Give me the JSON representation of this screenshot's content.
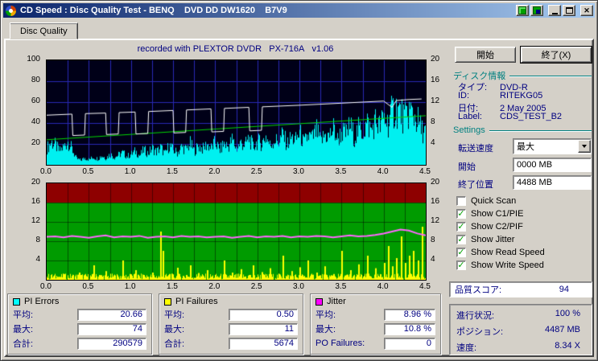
{
  "window": {
    "title": "CD Speed : Disc Quality Test - BENQ    DVD DD DW1620    B7V9"
  },
  "tab": {
    "label": "Disc Quality"
  },
  "chart_header": "recorded with PLEXTOR DVDR   PX-716A   v1.06",
  "colors": {
    "section_header": "#008080",
    "info_text": "#000080",
    "pi_errors": "#00FFFF",
    "pi_failures": "#FFFF00",
    "jitter": "#FF00FF"
  },
  "chart_data": [
    {
      "type": "area",
      "title": "PI Errors with read and write speed curves",
      "bg": "#000018",
      "grid_color": "#2828B4",
      "x_range": [
        0,
        4.5
      ],
      "x_grid_step": 0.25,
      "x_ticks": [
        0,
        0.5,
        1,
        1.5,
        2,
        2.5,
        3,
        3.5,
        4,
        4.5
      ],
      "x_tick_labels": [
        "0.0",
        "0.5",
        "1.0",
        "1.5",
        "2.0",
        "2.5",
        "3.0",
        "3.5",
        "4.0",
        "4.5"
      ],
      "scale_max": 100,
      "y_grid": [
        20,
        40,
        60,
        80
      ],
      "left_axis": {
        "ticks": [
          20,
          40,
          60,
          80,
          100
        ],
        "max": 100
      },
      "right_axis": {
        "ticks": [
          4,
          8,
          12,
          16,
          20
        ],
        "max": 20
      },
      "series": [
        {
          "name": "pi-errors",
          "legend": "PI Errors (C1/PIE)",
          "type": "spike-area",
          "color": "#00F0F0",
          "scale_max": 100,
          "x_step": 0.05,
          "values": [
            22,
            30,
            26,
            18,
            24,
            31,
            20,
            8,
            6,
            9,
            7,
            10,
            8,
            12,
            9,
            14,
            10,
            13,
            16,
            11,
            14,
            18,
            12,
            20,
            15,
            22,
            17,
            23,
            14,
            26,
            19,
            16,
            24,
            20,
            28,
            18,
            25,
            21,
            27,
            22,
            30,
            19,
            28,
            24,
            33,
            21,
            29,
            26,
            35,
            23,
            31,
            28,
            38,
            25,
            33,
            30,
            40,
            27,
            36,
            32,
            42,
            28,
            38,
            35,
            45,
            30,
            40,
            37,
            48,
            33,
            44,
            40,
            52,
            36,
            47,
            43,
            55,
            45,
            58,
            50,
            62,
            55,
            70,
            74,
            68,
            60,
            72,
            65,
            58,
            45
          ]
        },
        {
          "name": "write-speed",
          "legend": "Write Speed",
          "type": "line",
          "color": "#00D800",
          "scale_max": 20,
          "width": 1,
          "points": [
            [
              0,
              4.8
            ],
            [
              4.5,
              9.4
            ]
          ]
        },
        {
          "name": "read-speed",
          "legend": "Read Speed",
          "type": "line",
          "color": "#FFFFFF",
          "scale_max": 20,
          "width": 1,
          "points": [
            [
              0,
              9.5
            ],
            [
              0.3,
              9.7
            ],
            [
              0.31,
              5.6
            ],
            [
              0.45,
              5.7
            ],
            [
              0.46,
              9.8
            ],
            [
              0.7,
              9.9
            ],
            [
              0.71,
              5.8
            ],
            [
              0.85,
              5.9
            ],
            [
              0.86,
              10.0
            ],
            [
              1.05,
              10.1
            ],
            [
              1.06,
              5.9
            ],
            [
              1.2,
              6.0
            ],
            [
              1.21,
              10.2
            ],
            [
              1.5,
              10.4
            ],
            [
              1.51,
              6.1
            ],
            [
              1.65,
              6.2
            ],
            [
              1.66,
              10.5
            ],
            [
              1.95,
              10.7
            ],
            [
              1.96,
              6.3
            ],
            [
              2.1,
              6.4
            ],
            [
              2.11,
              10.8
            ],
            [
              2.4,
              11.0
            ],
            [
              2.41,
              6.5
            ],
            [
              2.55,
              6.6
            ],
            [
              2.56,
              11.1
            ],
            [
              3.0,
              11.4
            ],
            [
              3.5,
              11.8
            ],
            [
              4.0,
              12.2
            ],
            [
              4.1,
              11.0
            ],
            [
              4.15,
              12.3
            ],
            [
              4.3,
              12.5
            ],
            [
              4.45,
              12.6
            ]
          ]
        }
      ]
    },
    {
      "type": "bar",
      "title": "PI Failures and Jitter",
      "bg": "#009B00",
      "grid_color": "rgba(0,0,0,0.45)",
      "band": {
        "from": 16,
        "to": 20,
        "color": "#8E0000"
      },
      "x_range": [
        0,
        4.5
      ],
      "x_grid_step": 0.25,
      "x_ticks": [
        0,
        0.5,
        1,
        1.5,
        2,
        2.5,
        3,
        3.5,
        4,
        4.5
      ],
      "x_tick_labels": [
        "0.0",
        "0.5",
        "1.0",
        "1.5",
        "2.0",
        "2.5",
        "3.0",
        "3.5",
        "4.0",
        "4.5"
      ],
      "scale_max": 20,
      "y_grid": [
        4,
        8,
        12,
        16
      ],
      "left_axis": {
        "ticks": [
          4,
          8,
          12,
          16,
          20
        ],
        "max": 20
      },
      "right_axis": {
        "ticks": [
          4,
          8,
          12,
          16,
          20
        ],
        "max": 20
      },
      "series": [
        {
          "name": "pi-failures",
          "legend": "PI Failures (C2/PIF)",
          "type": "spikes",
          "color": "#FFFF00",
          "scale_max": 20,
          "floor": 1.3,
          "points": [
            [
              0.05,
              1
            ],
            [
              0.12,
              0.6
            ],
            [
              0.2,
              1.2
            ],
            [
              0.3,
              0.8
            ],
            [
              0.38,
              1.5
            ],
            [
              0.45,
              0.7
            ],
            [
              0.55,
              3
            ],
            [
              0.62,
              1
            ],
            [
              0.7,
              1.8
            ],
            [
              0.8,
              0.9
            ],
            [
              0.9,
              4
            ],
            [
              0.98,
              1.2
            ],
            [
              1.05,
              2
            ],
            [
              1.15,
              1
            ],
            [
              1.25,
              1.5
            ],
            [
              1.35,
              10
            ],
            [
              1.38,
              6
            ],
            [
              1.45,
              1.2
            ],
            [
              1.55,
              2.5
            ],
            [
              1.65,
              1
            ],
            [
              1.7,
              3
            ],
            [
              1.8,
              1.4
            ],
            [
              1.9,
              2
            ],
            [
              2.0,
              1
            ],
            [
              2.1,
              4
            ],
            [
              2.2,
              1.5
            ],
            [
              2.3,
              2.2
            ],
            [
              2.4,
              1
            ],
            [
              2.45,
              3
            ],
            [
              2.55,
              1.6
            ],
            [
              2.65,
              2.4
            ],
            [
              2.75,
              1.2
            ],
            [
              2.8,
              5
            ],
            [
              2.9,
              1.8
            ],
            [
              3.0,
              2.6
            ],
            [
              3.1,
              4
            ],
            [
              3.2,
              1.5
            ],
            [
              3.3,
              2.8
            ],
            [
              3.4,
              1.2
            ],
            [
              3.5,
              6
            ],
            [
              3.6,
              2
            ],
            [
              3.7,
              3.2
            ],
            [
              3.8,
              5
            ],
            [
              3.9,
              2.4
            ],
            [
              4.0,
              3.5
            ],
            [
              4.05,
              7
            ],
            [
              4.1,
              2.8
            ],
            [
              4.15,
              4.5
            ],
            [
              4.2,
              9
            ],
            [
              4.25,
              3.5
            ],
            [
              4.3,
              5
            ],
            [
              4.35,
              6
            ],
            [
              4.4,
              4
            ],
            [
              4.45,
              11
            ]
          ]
        },
        {
          "name": "jitter",
          "legend": "Jitter (%)",
          "type": "line",
          "color": "#FF66FF",
          "scale_max": 20,
          "width": 2,
          "x_step": 0.1,
          "values": [
            8.9,
            9.0,
            8.8,
            9.1,
            8.9,
            8.7,
            9.0,
            9.2,
            8.8,
            9.0,
            8.9,
            9.1,
            8.7,
            8.9,
            9.0,
            8.8,
            9.1,
            8.9,
            9.0,
            8.8,
            8.9,
            9.0,
            8.7,
            8.9,
            9.1,
            8.8,
            9.0,
            8.9,
            9.1,
            8.8,
            9.0,
            8.9,
            9.1,
            9.0,
            8.8,
            9.0,
            9.2,
            9.0,
            9.1,
            9.3,
            9.6,
            10.0,
            10.4,
            10.2,
            9.6,
            9.2
          ]
        }
      ]
    }
  ],
  "legend_boxes": [
    {
      "title": "PI Errors",
      "color": "#00FFFF",
      "rows": [
        {
          "label": "平均:",
          "value": "20.66"
        },
        {
          "label": "最大:",
          "value": "74"
        },
        {
          "label": "合計:",
          "value": "290579"
        }
      ]
    },
    {
      "title": "PI Failures",
      "color": "#FFFF00",
      "rows": [
        {
          "label": "平均:",
          "value": "0.50"
        },
        {
          "label": "最大:",
          "value": "11"
        },
        {
          "label": "合計:",
          "value": "5674"
        }
      ]
    },
    {
      "title": "Jitter",
      "color": "#FF00FF",
      "rows": [
        {
          "label": "平均:",
          "value": "8.96 %"
        },
        {
          "label": "最大:",
          "value": "10.8 %"
        },
        {
          "label": "PO Failures:",
          "value": "0"
        }
      ]
    }
  ],
  "sidebar": {
    "start_button": "開始",
    "exit_button": "終了(X)",
    "disc_info": {
      "header": "ディスク情報",
      "rows": [
        {
          "label": "タイプ:",
          "value": "DVD-R"
        },
        {
          "label": "ID:",
          "value": "RITEKG05"
        },
        {
          "label": "日付:",
          "value": "2 May 2005"
        },
        {
          "label": "Label:",
          "value": "CDS_TEST_B2"
        }
      ]
    },
    "settings": {
      "header": "Settings",
      "speed_label": "転送速度",
      "speed_value": "最大",
      "start_label": "開始",
      "start_value": "0000 MB",
      "end_label": "終了位置",
      "end_value": "4488 MB",
      "checkboxes": [
        {
          "label": "Quick Scan",
          "checked": false
        },
        {
          "label": "Show C1/PIE",
          "checked": true
        },
        {
          "label": "Show C2/PIF",
          "checked": true
        },
        {
          "label": "Show Jitter",
          "checked": true
        },
        {
          "label": "Show Read Speed",
          "checked": true
        },
        {
          "label": "Show Write Speed",
          "checked": true
        }
      ]
    },
    "score": {
      "label": "品質スコア:",
      "value": "94"
    },
    "status": [
      {
        "label": "進行状況:",
        "value": "100 %"
      },
      {
        "label": "ポジション:",
        "value": "4487 MB"
      },
      {
        "label": "速度:",
        "value": "8.34 X"
      }
    ]
  }
}
